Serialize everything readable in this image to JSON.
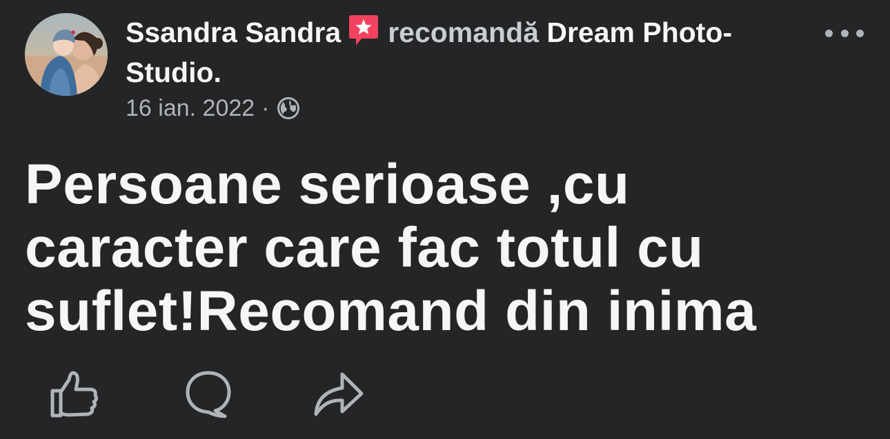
{
  "post": {
    "author_name": "Ssandra Sandra",
    "recommend_verb": "recomandă",
    "page_name": "Dream Photo-Studio.",
    "date": "16 ian. 2022",
    "separator": "·",
    "privacy_icon": "globe-icon",
    "recommendation_icon": "recommend-star-badge-icon",
    "body": "Persoane serioase ,cu caracter care fac totul cu suflet!Recomand din inima"
  },
  "actions": {
    "like_icon": "thumbs-up-icon",
    "comment_icon": "comment-bubble-icon",
    "share_icon": "share-arrow-icon"
  },
  "colors": {
    "background": "#242526",
    "primary_text": "#f5f6f7",
    "secondary_text": "#b0b3b8",
    "badge": "#f3425f"
  }
}
